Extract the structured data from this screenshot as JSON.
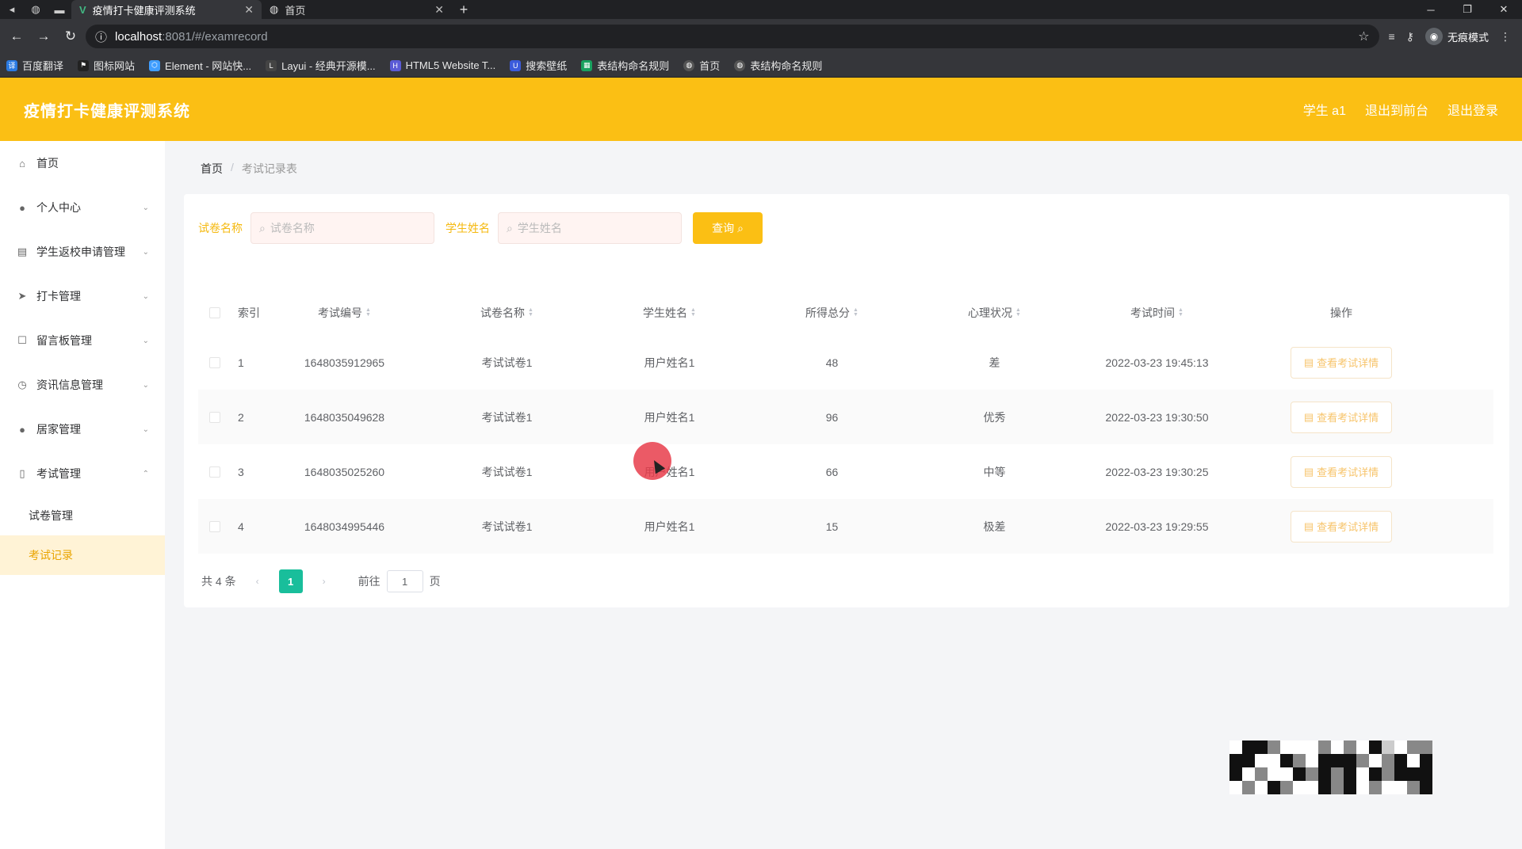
{
  "browser": {
    "tabs": [
      {
        "title": "疫情打卡健康评测系统",
        "active": true
      },
      {
        "title": "首页",
        "active": false
      }
    ],
    "url_host": "localhost",
    "url_path": ":8081/#/examrecord",
    "profile_label": "无痕模式",
    "bookmarks": [
      {
        "label": "百度翻译",
        "color": "#2a7ae2"
      },
      {
        "label": "图标网站",
        "color": "#222222"
      },
      {
        "label": "Element - 网站快...",
        "color": "#409eff"
      },
      {
        "label": "Layui - 经典开源模...",
        "color": "#444444"
      },
      {
        "label": "HTML5 Website T...",
        "color": "#5b5bd6"
      },
      {
        "label": "搜索壁纸",
        "color": "#3b5bdb"
      },
      {
        "label": "表结构命名规则",
        "color": "#19a15f"
      },
      {
        "label": "首页",
        "color": "#555555"
      },
      {
        "label": "表结构命名规则",
        "color": "#555555"
      }
    ]
  },
  "header": {
    "title": "疫情打卡健康评测系统",
    "user": "学生 a1",
    "back_to_front": "退出到前台",
    "logout": "退出登录",
    "accent": "#fbbf14"
  },
  "sidebar": {
    "items": [
      {
        "label": "首页",
        "icon": "home-icon",
        "glyph": "⌂",
        "arrow": ""
      },
      {
        "label": "个人中心",
        "icon": "user-icon",
        "glyph": "●",
        "arrow": "⌄"
      },
      {
        "label": "学生返校申请管理",
        "icon": "clipboard-icon",
        "glyph": "▤",
        "arrow": "⌄"
      },
      {
        "label": "打卡管理",
        "icon": "send-icon",
        "glyph": "➤",
        "arrow": "⌄"
      },
      {
        "label": "留言板管理",
        "icon": "message-icon",
        "glyph": "☐",
        "arrow": "⌄"
      },
      {
        "label": "资讯信息管理",
        "icon": "info-icon",
        "glyph": "◷",
        "arrow": "⌄"
      },
      {
        "label": "居家管理",
        "icon": "person-icon",
        "glyph": "●",
        "arrow": "⌄"
      },
      {
        "label": "考试管理",
        "icon": "phone-icon",
        "glyph": "▯",
        "arrow": "⌃"
      }
    ],
    "subitems": [
      {
        "label": "试卷管理",
        "active": false
      },
      {
        "label": "考试记录",
        "active": true
      }
    ]
  },
  "breadcrumb": {
    "home": "首页",
    "separator": "/",
    "current": "考试记录表"
  },
  "filters": {
    "paper_label": "试卷名称",
    "paper_placeholder": "试卷名称",
    "student_label": "学生姓名",
    "student_placeholder": "学生姓名",
    "search_button": "查询"
  },
  "table": {
    "headers": {
      "index": "索引",
      "exam_no": "考试编号",
      "paper": "试卷名称",
      "student": "学生姓名",
      "score": "所得总分",
      "mood": "心理状况",
      "time": "考试时间",
      "ops": "操作"
    },
    "action_label": "查看考试详情",
    "rows": [
      {
        "index": "1",
        "exam_no": "1648035912965",
        "paper": "考试试卷1",
        "student": "用户姓名1",
        "score": "48",
        "mood": "差",
        "time": "2022-03-23 19:45:13"
      },
      {
        "index": "2",
        "exam_no": "1648035049628",
        "paper": "考试试卷1",
        "student": "用户姓名1",
        "score": "96",
        "mood": "优秀",
        "time": "2022-03-23 19:30:50"
      },
      {
        "index": "3",
        "exam_no": "1648035025260",
        "paper": "考试试卷1",
        "student": "用户姓名1",
        "score": "66",
        "mood": "中等",
        "time": "2022-03-23 19:30:25"
      },
      {
        "index": "4",
        "exam_no": "1648034995446",
        "paper": "考试试卷1",
        "student": "用户姓名1",
        "score": "15",
        "mood": "极差",
        "time": "2022-03-23 19:29:55"
      }
    ]
  },
  "pagination": {
    "total": "共 4 条",
    "current_page": "1",
    "goto_prefix": "前往",
    "goto_value": "1",
    "goto_suffix": "页"
  }
}
